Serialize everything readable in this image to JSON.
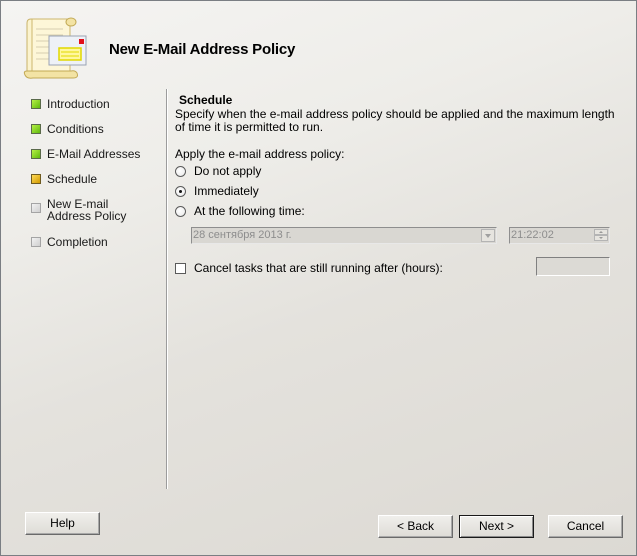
{
  "window": {
    "title": "New E-Mail Address Policy",
    "header_icon": "scroll-envelope-icon"
  },
  "colors": {
    "step_done": "#7ed321",
    "step_current": "#e8b21a",
    "step_pending": "#d8d8d8"
  },
  "nav": {
    "items": [
      {
        "label": "Introduction",
        "status": "done"
      },
      {
        "label": "Conditions",
        "status": "done"
      },
      {
        "label": "E-Mail Addresses",
        "status": "done"
      },
      {
        "label": "Schedule",
        "status": "current"
      },
      {
        "label": "New E-mail Address Policy",
        "status": "pending"
      },
      {
        "label": "Completion",
        "status": "pending"
      }
    ]
  },
  "page": {
    "section_title": "Schedule",
    "description": "Specify when the e-mail address policy should be applied and the maximum length of time it is permitted to run.",
    "apply_label": "Apply the e-mail address policy:",
    "options": [
      {
        "label": "Do not apply",
        "checked": false
      },
      {
        "label": "Immediately",
        "checked": true
      },
      {
        "label": "At the following time:",
        "checked": false
      }
    ],
    "date_value": "28 сентября 2013 г.",
    "time_value": "21:22:02",
    "cancel_tasks_label": "Cancel tasks that are still running after (hours):",
    "cancel_tasks_checked": false,
    "hours_value": ""
  },
  "footer": {
    "help": "Help",
    "back": "< Back",
    "next": "Next >",
    "cancel": "Cancel"
  }
}
